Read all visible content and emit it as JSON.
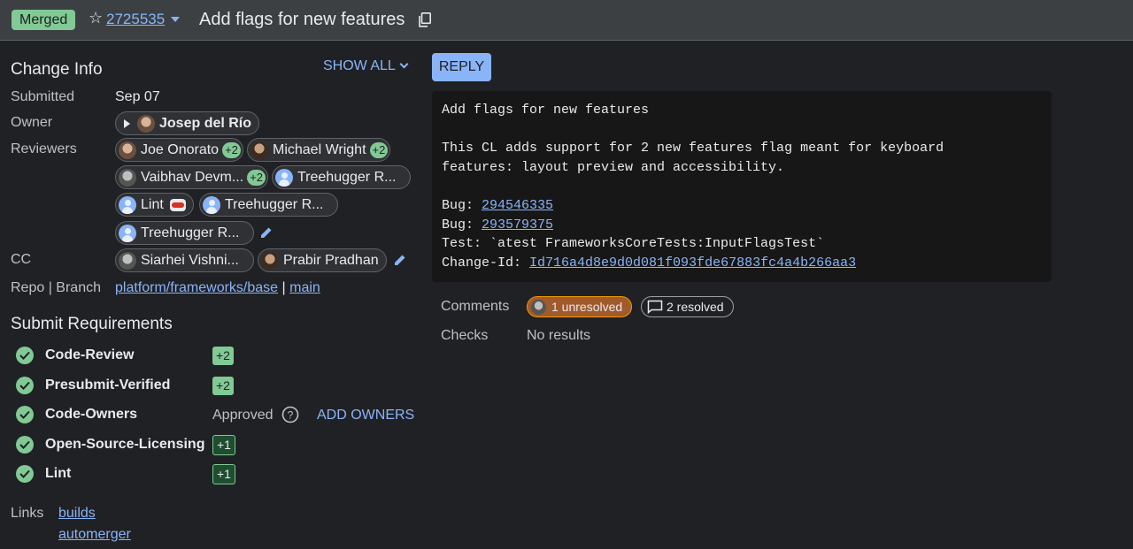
{
  "header": {
    "status": "Merged",
    "change_number": "2725535",
    "title": "Add flags for new features"
  },
  "change_info": {
    "heading": "Change Info",
    "show_all": "SHOW ALL",
    "submitted_label": "Submitted",
    "submitted_value": "Sep 07",
    "owner_label": "Owner",
    "owner_name": "Josep del Río",
    "reviewers_label": "Reviewers",
    "reviewers": [
      {
        "name": "Joe Onorato",
        "vote": "+2"
      },
      {
        "name": "Michael Wright",
        "vote": "+2"
      },
      {
        "name": "Vaibhav Devm...",
        "vote": "+2"
      },
      {
        "name": "Treehugger R..."
      },
      {
        "name": "Lint"
      },
      {
        "name": "Treehugger R..."
      },
      {
        "name": "Treehugger R..."
      }
    ],
    "cc_label": "CC",
    "cc": [
      {
        "name": "Siarhei Vishni..."
      },
      {
        "name": "Prabir Pradhan"
      }
    ],
    "repo_label": "Repo | Branch",
    "repo": "platform/frameworks/base",
    "separator": "|",
    "branch": "main"
  },
  "submit_requirements": {
    "heading": "Submit Requirements",
    "items": [
      {
        "name": "Code-Review",
        "vote": "+2"
      },
      {
        "name": "Presubmit-Verified",
        "vote": "+2"
      },
      {
        "name": "Code-Owners",
        "status": "Approved",
        "action": "ADD OWNERS"
      },
      {
        "name": "Open-Source-Licensing",
        "vote": "+1"
      },
      {
        "name": "Lint",
        "vote": "+1"
      }
    ]
  },
  "links": {
    "label": "Links",
    "items": [
      "builds",
      "automerger"
    ]
  },
  "reply_label": "REPLY",
  "commit_message": {
    "subject": "Add flags for new features",
    "body_line1": "This CL adds support for 2 new features flag meant for keyboard",
    "body_line2": "features: layout preview and accessibility.",
    "bug_label": "Bug: ",
    "bug1": "294546335",
    "bug2": "293579375",
    "test_line": "Test: `atest FrameworksCoreTests:InputFlagsTest`",
    "change_id_label": "Change-Id: ",
    "change_id": "Id716a4d8e9d0d081f093fde67883fc4a4b266aa3"
  },
  "comments": {
    "label": "Comments",
    "unresolved": "1 unresolved",
    "resolved": "2 resolved"
  },
  "checks": {
    "label": "Checks",
    "value": "No results"
  },
  "colors": {
    "accent": "#8ab4f8",
    "approved_green": "#81c995",
    "unresolved_orange": "#a05a2c",
    "background": "#202124"
  }
}
